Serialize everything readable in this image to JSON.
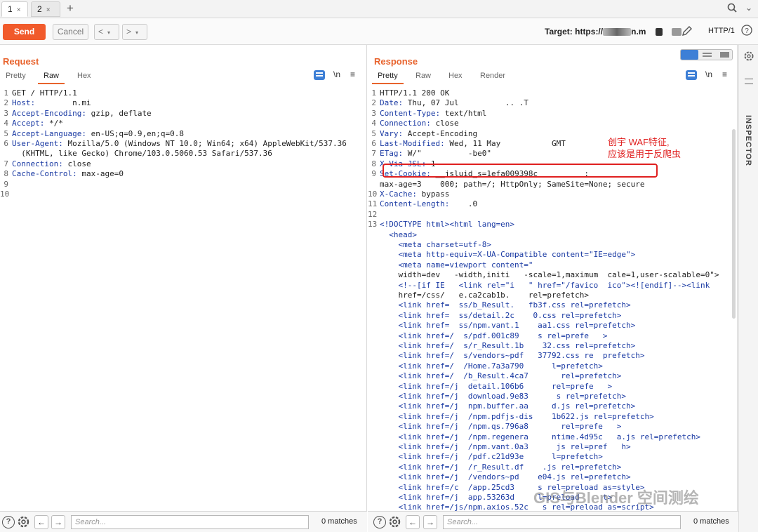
{
  "tabs": [
    {
      "label": "1"
    },
    {
      "label": "2"
    }
  ],
  "toolbar": {
    "send": "Send",
    "cancel": "Cancel",
    "back": "<",
    "forward": ">",
    "target_prefix": "Target: https://",
    "target_suffix": "n.m",
    "protocol": "HTTP/1"
  },
  "request": {
    "title": "Request",
    "tabs": [
      "Pretty",
      "Raw",
      "Hex"
    ],
    "active_tab": "Raw",
    "lines": [
      {
        "n": "1",
        "text": "GET / HTTP/1.1"
      },
      {
        "n": "2",
        "key": "Host:",
        "text": "        n.mi"
      },
      {
        "n": "3",
        "key": "Accept-Encoding:",
        "text": " gzip, deflate"
      },
      {
        "n": "4",
        "key": "Accept:",
        "text": " */*"
      },
      {
        "n": "5",
        "key": "Accept-Language:",
        "text": " en-US;q=0.9,en;q=0.8"
      },
      {
        "n": "6",
        "key": "User-Agent:",
        "text": " Mozilla/5.0 (Windows NT 10.0; Win64; x64) AppleWebKit/537.36"
      },
      {
        "n": "",
        "text": "  (KHTML, like Gecko) Chrome/103.0.5060.53 Safari/537.36"
      },
      {
        "n": "7",
        "key": "Connection:",
        "text": " close"
      },
      {
        "n": "8",
        "key": "Cache-Control:",
        "text": " max-age=0"
      },
      {
        "n": "9",
        "text": ""
      },
      {
        "n": "10",
        "text": ""
      }
    ],
    "search_placeholder": "Search...",
    "matches": "0 matches"
  },
  "response": {
    "title": "Response",
    "tabs": [
      "Pretty",
      "Raw",
      "Hex",
      "Render"
    ],
    "active_tab": "Pretty",
    "lines": [
      {
        "n": "1",
        "text": "HTTP/1.1 200 OK"
      },
      {
        "n": "2",
        "key": "Date:",
        "text": " Thu, 07 Jul          .. .T"
      },
      {
        "n": "3",
        "key": "Content-Type:",
        "text": " text/html"
      },
      {
        "n": "4",
        "key": "Connection:",
        "text": " close"
      },
      {
        "n": "5",
        "key": "Vary:",
        "text": " Accept-Encoding"
      },
      {
        "n": "6",
        "key": "Last-Modified:",
        "text": " Wed, 11 May           GMT"
      },
      {
        "n": "7",
        "key": "ETag:",
        "text": " W/\"          -be0\""
      },
      {
        "n": "8",
        "key": "X-Via-JSL:",
        "text": " 1          "
      },
      {
        "n": "9",
        "key": "Set-Cookie:",
        "text": " __jsluid_s=1efa009398c          ;"
      },
      {
        "n": "",
        "text": "max-age=3    000; path=/; HttpOnly; SameSite=None; secure"
      },
      {
        "n": "10",
        "key": "X-Cache:",
        "text": " bypass"
      },
      {
        "n": "11",
        "key": "Content-Length:",
        "text": "    .0"
      },
      {
        "n": "12",
        "text": ""
      },
      {
        "n": "13",
        "text": "<!DOCTYPE html><html lang=en>"
      },
      {
        "n": "",
        "text": "  <head>"
      },
      {
        "n": "",
        "text": "    <meta charset=utf-8>"
      },
      {
        "n": "",
        "text": "    <meta http-equiv=X-UA-Compatible content=\"IE=edge\">"
      },
      {
        "n": "",
        "text": "    <meta name=viewport content=\""
      },
      {
        "n": "",
        "text": "    width=dev   -width,initi   -scale=1,maximum  cale=1,user-scalable=0\">"
      },
      {
        "n": "",
        "text": "    <!--[if IE   <link rel=\"i   \" href=\"/favico  ico\"><![endif]--><link"
      },
      {
        "n": "",
        "text": "    href=/css/   e.ca2cab1b.    rel=prefetch>"
      },
      {
        "n": "",
        "text": "    <link href=  ss/b_Result.   fb3f.css rel=prefetch>"
      },
      {
        "n": "",
        "text": "    <link href=  ss/detail.2c    0.css rel=prefetch>"
      },
      {
        "n": "",
        "text": "    <link href=  ss/npm.vant.1    aa1.css rel=prefetch>"
      },
      {
        "n": "",
        "text": "    <link href=/  s/pdf.001c89    s rel=prefe   >"
      },
      {
        "n": "",
        "text": "    <link href=/  s/r_Result.1b    32.css rel=prefetch>"
      },
      {
        "n": "",
        "text": "    <link href=/  s/vendors~pdf   37792.css re  prefetch>"
      },
      {
        "n": "",
        "text": "    <link href=/  /Home.7a3a790      l=prefetch>"
      },
      {
        "n": "",
        "text": "    <link href=/  /b_Result.4ca7       rel=prefetch>"
      },
      {
        "n": "",
        "text": "    <link href=/j  detail.106b6      rel=prefe   >"
      },
      {
        "n": "",
        "text": "    <link href=/j  download.9e83      s rel=prefetch>"
      },
      {
        "n": "",
        "text": "    <link href=/j  npm.buffer.aa     d.js rel=prefetch>"
      },
      {
        "n": "",
        "text": "    <link href=/j  /npm.pdfjs-dis    1b622.js rel=prefetch>"
      },
      {
        "n": "",
        "text": "    <link href=/j  /npm.qs.796a8       rel=prefe   >"
      },
      {
        "n": "",
        "text": "    <link href=/j  /npm.regenera     ntime.4d95c   a.js rel=prefetch>"
      },
      {
        "n": "",
        "text": "    <link href=/j  /npm.vant.0a3      js rel=pref   h>"
      },
      {
        "n": "",
        "text": "    <link href=/j  /pdf.c21d93e      l=prefetch>"
      },
      {
        "n": "",
        "text": "    <link href=/j  /r_Result.df    .js rel=prefetch>"
      },
      {
        "n": "",
        "text": "    <link href=/j  /vendors~pd    e04.js rel=prefetch>"
      },
      {
        "n": "",
        "text": "    <link href=/c  /app.25cd3     s rel=preload as=style>"
      },
      {
        "n": "",
        "text": "    <link href=/j  app.53263d     l=preload     t>"
      },
      {
        "n": "",
        "text": "    <link href=/js/npm.axios.52c   s rel=preload as=script>"
      }
    ],
    "annotation": "创宇 WAF特征,\n应该是用于反爬虫",
    "search_placeholder": "Search...",
    "matches": "0 matches"
  },
  "inspector": {
    "label": "INSPECTOR"
  },
  "watermark": "GIS与Blender 空间测绘",
  "colors": {
    "accent": "#e8632d",
    "send": "#f15a2b",
    "highlight": "#e02020"
  }
}
